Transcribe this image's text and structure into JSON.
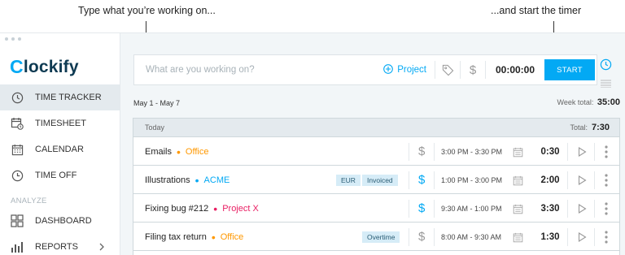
{
  "captions": {
    "left": "Type what you’re working on...",
    "right": "...and start the timer"
  },
  "brand": {
    "logo_letter": "C",
    "logo_rest": "lockify"
  },
  "sidebar": {
    "items": [
      {
        "label": "TIME TRACKER",
        "icon": "clock-icon",
        "active": true
      },
      {
        "label": "TIMESHEET",
        "icon": "timesheet-icon"
      },
      {
        "label": "CALENDAR",
        "icon": "calendar-icon"
      },
      {
        "label": "TIME OFF",
        "icon": "time-off-icon"
      }
    ],
    "section_label": "ANALYZE",
    "analyze_items": [
      {
        "label": "DASHBOARD",
        "icon": "dashboard-icon"
      },
      {
        "label": "REPORTS",
        "icon": "reports-icon",
        "has_chevron": true
      }
    ]
  },
  "timer": {
    "placeholder": "What are you working on?",
    "project_label": "Project",
    "value": "00:00:00",
    "start_label": "START"
  },
  "week": {
    "range": "May 1 - May 7",
    "total_label": "Week total:",
    "total": "35:00"
  },
  "day": {
    "label": "Today",
    "total_label": "Total:",
    "total": "7:30"
  },
  "entries": [
    {
      "description": "Emails",
      "project": "Office",
      "project_color": "#ff9800",
      "tags": [],
      "billable": false,
      "time_range": "3:00 PM - 3:30 PM",
      "duration": "0:30"
    },
    {
      "description": "Illustrations",
      "project": "ACME",
      "project_color": "#03a9f4",
      "tags": [
        "EUR",
        "Invoiced"
      ],
      "billable": true,
      "time_range": "1:00 PM - 3:00 PM",
      "duration": "2:00"
    },
    {
      "description": "Fixing bug #212",
      "project": "Project X",
      "project_color": "#e91e63",
      "tags": [],
      "billable": true,
      "time_range": "9:30 AM - 1:00 PM",
      "duration": "3:30"
    },
    {
      "description": "Filing tax return",
      "project": "Office",
      "project_color": "#ff9800",
      "tags": [
        "Overtime"
      ],
      "billable": false,
      "time_range": "8:00 AM - 9:30 AM",
      "duration": "1:30"
    }
  ],
  "colors": {
    "accent": "#03a9f4",
    "brand_dark": "#0e3a52"
  }
}
